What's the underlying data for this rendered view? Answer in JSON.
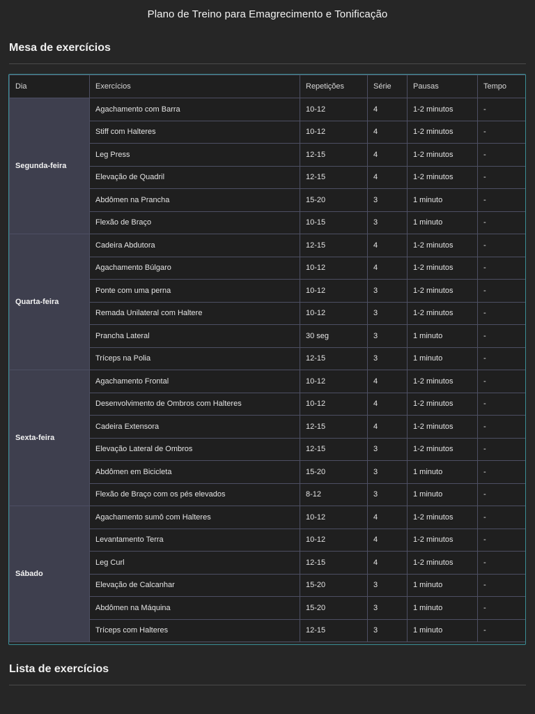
{
  "page": {
    "title": "Plano de Treino para Emagrecimento e Tonificação"
  },
  "sections": {
    "table_title": "Mesa de exercícios",
    "list_title": "Lista de exercícios"
  },
  "table": {
    "headers": [
      "Dia",
      "Exercícios",
      "Repetições",
      "Série",
      "Pausas",
      "Tempo"
    ],
    "days": [
      {
        "day": "Segunda-feira",
        "rows": [
          [
            "Agachamento com Barra",
            "10-12",
            "4",
            "1-2 minutos",
            "-"
          ],
          [
            "Stiff com Halteres",
            "10-12",
            "4",
            "1-2 minutos",
            "-"
          ],
          [
            "Leg Press",
            "12-15",
            "4",
            "1-2 minutos",
            "-"
          ],
          [
            "Elevação de Quadril",
            "12-15",
            "4",
            "1-2 minutos",
            "-"
          ],
          [
            "Abdômen na Prancha",
            "15-20",
            "3",
            "1 minuto",
            "-"
          ],
          [
            "Flexão de Braço",
            "10-15",
            "3",
            "1 minuto",
            "-"
          ]
        ]
      },
      {
        "day": "Quarta-feira",
        "rows": [
          [
            "Cadeira Abdutora",
            "12-15",
            "4",
            "1-2 minutos",
            "-"
          ],
          [
            "Agachamento Búlgaro",
            "10-12",
            "4",
            "1-2 minutos",
            "-"
          ],
          [
            "Ponte com uma perna",
            "10-12",
            "3",
            "1-2 minutos",
            "-"
          ],
          [
            "Remada Unilateral com Haltere",
            "10-12",
            "3",
            "1-2 minutos",
            "-"
          ],
          [
            "Prancha Lateral",
            "30 seg",
            "3",
            "1 minuto",
            "-"
          ],
          [
            "Tríceps na Polia",
            "12-15",
            "3",
            "1 minuto",
            "-"
          ]
        ]
      },
      {
        "day": "Sexta-feira",
        "rows": [
          [
            "Agachamento Frontal",
            "10-12",
            "4",
            "1-2 minutos",
            "-"
          ],
          [
            "Desenvolvimento de Ombros com Halteres",
            "10-12",
            "4",
            "1-2 minutos",
            "-"
          ],
          [
            "Cadeira Extensora",
            "12-15",
            "4",
            "1-2 minutos",
            "-"
          ],
          [
            "Elevação Lateral de Ombros",
            "12-15",
            "3",
            "1-2 minutos",
            "-"
          ],
          [
            "Abdômen em Bicicleta",
            "15-20",
            "3",
            "1 minuto",
            "-"
          ],
          [
            "Flexão de Braço com os pés elevados",
            "8-12",
            "3",
            "1 minuto",
            "-"
          ]
        ]
      },
      {
        "day": "Sábado",
        "rows": [
          [
            "Agachamento sumô com Halteres",
            "10-12",
            "4",
            "1-2 minutos",
            "-"
          ],
          [
            "Levantamento Terra",
            "10-12",
            "4",
            "1-2 minutos",
            "-"
          ],
          [
            "Leg Curl",
            "12-15",
            "4",
            "1-2 minutos",
            "-"
          ],
          [
            "Elevação de Calcanhar",
            "15-20",
            "3",
            "1 minuto",
            "-"
          ],
          [
            "Abdômen na Máquina",
            "15-20",
            "3",
            "1 minuto",
            "-"
          ],
          [
            "Tríceps com Halteres",
            "12-15",
            "3",
            "1 minuto",
            "-"
          ]
        ]
      }
    ]
  }
}
